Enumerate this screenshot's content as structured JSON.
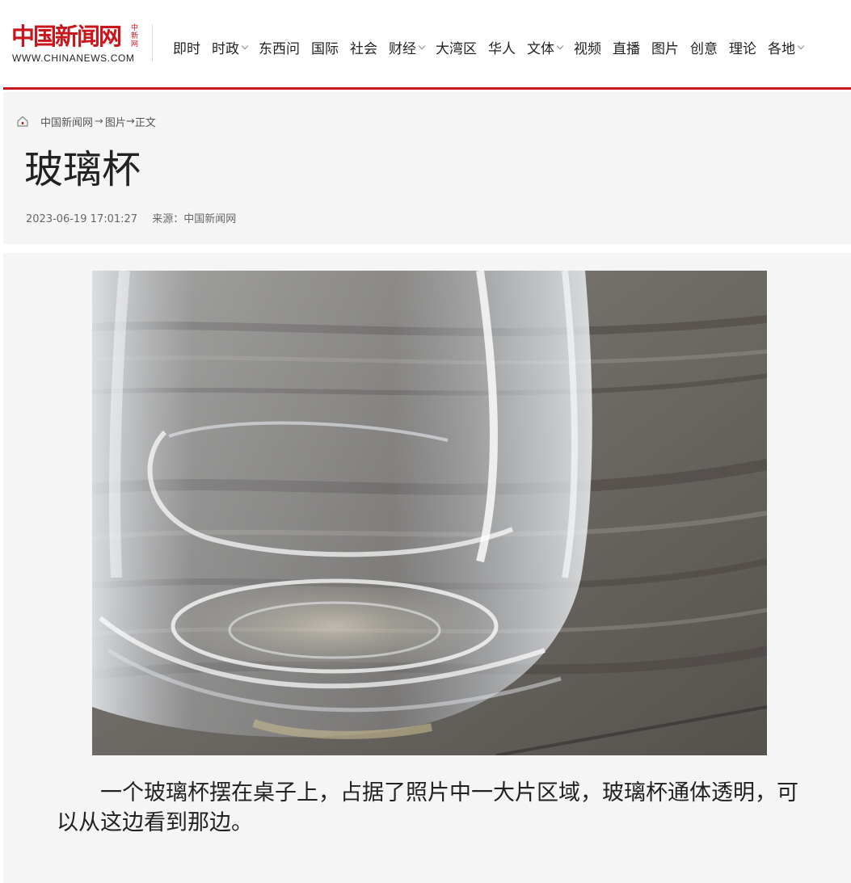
{
  "site": {
    "logo_cn": "中国新闻网",
    "logo_side": "中新网",
    "logo_en": "WWW.CHINANEWS.COM"
  },
  "nav": [
    {
      "label": "即时",
      "dropdown": false
    },
    {
      "label": "时政",
      "dropdown": true
    },
    {
      "label": "东西问",
      "dropdown": false
    },
    {
      "label": "国际",
      "dropdown": false
    },
    {
      "label": "社会",
      "dropdown": false
    },
    {
      "label": "财经",
      "dropdown": true
    },
    {
      "label": "大湾区",
      "dropdown": false
    },
    {
      "label": "华人",
      "dropdown": false
    },
    {
      "label": "文体",
      "dropdown": true
    },
    {
      "label": "视频",
      "dropdown": false
    },
    {
      "label": "直播",
      "dropdown": false
    },
    {
      "label": "图片",
      "dropdown": false
    },
    {
      "label": "创意",
      "dropdown": false
    },
    {
      "label": "理论",
      "dropdown": false
    },
    {
      "label": "各地",
      "dropdown": true
    }
  ],
  "breadcrumb": {
    "home": "中国新闻网",
    "arrow1": "→",
    "section": "图片",
    "arrow2": "→",
    "current": "正文"
  },
  "article": {
    "title": "玻璃杯",
    "datetime": "2023-06-19 17:01:27",
    "source": "来源：中国新闻网",
    "caption": "一个玻璃杯摆在桌子上，占据了照片中一大片区域，玻璃杯通体透明，可以从这边看到那边。"
  },
  "colors": {
    "brand_red": "#c8161d",
    "panel_bg": "#f5f5f5"
  },
  "icons": {
    "home": "home-icon",
    "dropdown": "chevron-down-icon"
  }
}
